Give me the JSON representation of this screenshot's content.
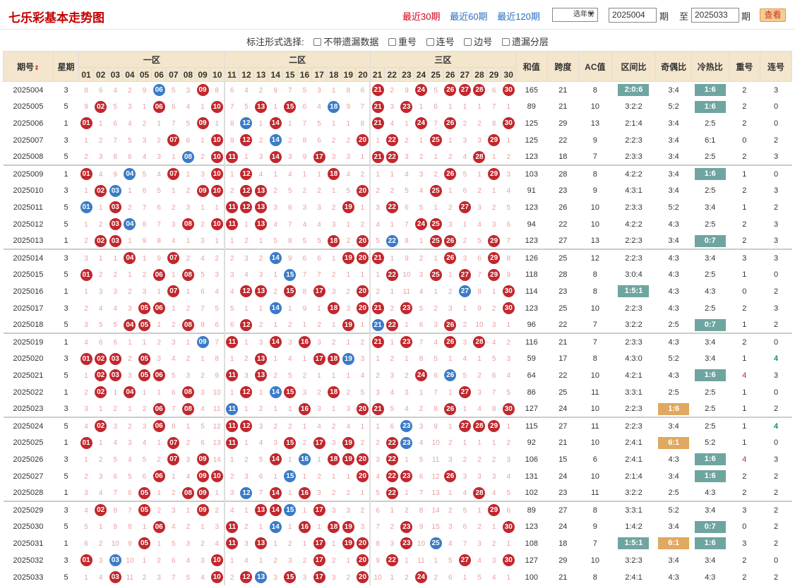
{
  "header": {
    "title": "七乐彩基本走势图",
    "ranges": [
      "最近30期",
      "最近60期",
      "最近120期"
    ],
    "year_select": "选年份",
    "start_issue": "2025004",
    "end_issue": "2025033",
    "label_from": "期",
    "label_to": "至",
    "label_issue": "期",
    "query": "查看"
  },
  "options": {
    "label": "标注形式选择:",
    "items": [
      "不带遗漏数据",
      "重号",
      "连号",
      "边号",
      "遗漏分层"
    ]
  },
  "columns": {
    "issue": "期号",
    "week": "星期",
    "zones": [
      "一区",
      "二区",
      "三区"
    ],
    "sum": "和值",
    "span": "跨度",
    "ac": "AC值",
    "zone_ratio": "区间比",
    "odd_even": "奇偶比",
    "hot_cold": "冷热比",
    "repeat": "重号",
    "consec": "连号"
  },
  "rows": [
    [
      "2025004",
      "3",
      [
        6,
        9,
        21,
        24,
        26,
        27,
        28,
        30
      ],
      [
        6
      ],
      "165",
      "21",
      "8",
      "2:0:6",
      "3:4",
      "1:6",
      "2",
      "3"
    ],
    [
      "2025005",
      "5",
      [
        2,
        6,
        10,
        13,
        15,
        18,
        21,
        23
      ],
      [
        18
      ],
      "89",
      "21",
      "10",
      "3:2:2",
      "5:2",
      "1:6",
      "2",
      "0"
    ],
    [
      "2025006",
      "1",
      [
        1,
        9,
        12,
        14,
        21,
        24,
        26,
        30
      ],
      [
        12
      ],
      "125",
      "29",
      "13",
      "2:1:4",
      "3:4",
      "2:5",
      "2",
      "0"
    ],
    [
      "2025007",
      "3",
      [
        7,
        10,
        12,
        14,
        20,
        22,
        25,
        29
      ],
      [
        14
      ],
      "125",
      "22",
      "9",
      "2:2:3",
      "3:4",
      "6:1",
      "0",
      "2"
    ],
    [
      "2025008",
      "5",
      [
        8,
        10,
        11,
        14,
        17,
        21,
        22,
        28
      ],
      [
        8
      ],
      "123",
      "18",
      "7",
      "2:3:3",
      "3:4",
      "2:5",
      "2",
      "3"
    ],
    [
      "2025009",
      "1",
      [
        1,
        4,
        7,
        10,
        12,
        18,
        26,
        29
      ],
      [
        4
      ],
      "103",
      "28",
      "8",
      "4:2:2",
      "3:4",
      "1:6",
      "1",
      "0"
    ],
    [
      "2025010",
      "3",
      [
        2,
        3,
        9,
        10,
        12,
        13,
        20,
        25
      ],
      [
        3
      ],
      "91",
      "23",
      "9",
      "4:3:1",
      "3:4",
      "2:5",
      "2",
      "3"
    ],
    [
      "2025011",
      "5",
      [
        1,
        3,
        11,
        12,
        13,
        19,
        22,
        27
      ],
      [
        1
      ],
      "123",
      "26",
      "10",
      "2:3:3",
      "5:2",
      "3:4",
      "1",
      "2"
    ],
    [
      "2025012",
      "5",
      [
        3,
        4,
        8,
        10,
        11,
        13,
        24,
        25
      ],
      [
        4
      ],
      "94",
      "22",
      "10",
      "4:2:2",
      "4:3",
      "2:5",
      "2",
      "3"
    ],
    [
      "2025013",
      "1",
      [
        2,
        3,
        18,
        20,
        22,
        25,
        26,
        29
      ],
      [
        22
      ],
      "123",
      "27",
      "13",
      "2:2:3",
      "3:4",
      "0:7",
      "2",
      "3"
    ],
    [
      "2025014",
      "3",
      [
        4,
        7,
        14,
        19,
        20,
        21,
        26,
        29
      ],
      [
        14
      ],
      "126",
      "25",
      "12",
      "2:2:3",
      "4:3",
      "3:4",
      "3",
      "3"
    ],
    [
      "2025015",
      "5",
      [
        1,
        6,
        8,
        15,
        22,
        25,
        27,
        29
      ],
      [
        15
      ],
      "118",
      "28",
      "8",
      "3:0:4",
      "4:3",
      "2:5",
      "1",
      "0"
    ],
    [
      "2025016",
      "1",
      [
        7,
        12,
        13,
        15,
        17,
        20,
        27,
        30
      ],
      [
        27
      ],
      "114",
      "23",
      "8",
      "1:5:1",
      "4:3",
      "4:3",
      "0",
      "2"
    ],
    [
      "2025017",
      "3",
      [
        5,
        6,
        14,
        18,
        20,
        21,
        23,
        30
      ],
      [
        14
      ],
      "123",
      "25",
      "10",
      "2:2:3",
      "4:3",
      "2:5",
      "2",
      "3"
    ],
    [
      "2025018",
      "5",
      [
        4,
        5,
        8,
        12,
        19,
        21,
        22,
        26
      ],
      [
        21
      ],
      "96",
      "22",
      "7",
      "3:2:2",
      "2:5",
      "0:7",
      "1",
      "2"
    ],
    [
      "2025019",
      "1",
      [
        9,
        11,
        14,
        16,
        21,
        23,
        26,
        28
      ],
      [
        9
      ],
      "116",
      "21",
      "7",
      "2:3:3",
      "4:3",
      "3:4",
      "2",
      "0"
    ],
    [
      "2025020",
      "3",
      [
        1,
        2,
        3,
        5,
        13,
        17,
        18,
        19
      ],
      [
        19
      ],
      "59",
      "17",
      "8",
      "4:3:0",
      "5:2",
      "3:4",
      "1",
      "4"
    ],
    [
      "2025021",
      "5",
      [
        2,
        3,
        5,
        6,
        11,
        13,
        24,
        26
      ],
      [
        26
      ],
      "64",
      "22",
      "10",
      "4:2:1",
      "4:3",
      "1:6",
      "4",
      "3"
    ],
    [
      "2025022",
      "1",
      [
        2,
        4,
        8,
        12,
        14,
        15,
        18,
        27
      ],
      [
        14
      ],
      "86",
      "25",
      "11",
      "3:3:1",
      "2:5",
      "2:5",
      "1",
      "0"
    ],
    [
      "2025023",
      "3",
      [
        6,
        8,
        11,
        16,
        20,
        21,
        26,
        30
      ],
      [
        11
      ],
      "127",
      "24",
      "10",
      "2:2:3",
      "1:6",
      "2:5",
      "1",
      "2"
    ],
    [
      "2025024",
      "5",
      [
        2,
        6,
        11,
        12,
        23,
        27,
        28,
        29
      ],
      [
        23
      ],
      "115",
      "27",
      "11",
      "2:2:3",
      "3:4",
      "2:5",
      "1",
      "4"
    ],
    [
      "2025025",
      "1",
      [
        1,
        7,
        11,
        15,
        17,
        19,
        22,
        23
      ],
      [
        23
      ],
      "92",
      "21",
      "10",
      "2:4:1",
      "6:1",
      "5:2",
      "1",
      "0"
    ],
    [
      "2025026",
      "3",
      [
        7,
        9,
        14,
        16,
        18,
        19,
        20,
        22
      ],
      [
        16
      ],
      "106",
      "15",
      "6",
      "2:4:1",
      "4:3",
      "1:6",
      "4",
      "3"
    ],
    [
      "2025027",
      "5",
      [
        6,
        9,
        10,
        15,
        20,
        22,
        23,
        26
      ],
      [
        15
      ],
      "131",
      "24",
      "10",
      "2:1:4",
      "3:4",
      "1:6",
      "2",
      "2"
    ],
    [
      "2025028",
      "1",
      [
        5,
        8,
        9,
        12,
        14,
        16,
        22,
        28
      ],
      [
        12
      ],
      "102",
      "23",
      "11",
      "3:2:2",
      "2:5",
      "4:3",
      "2",
      "2"
    ],
    [
      "2025029",
      "3",
      [
        2,
        5,
        9,
        13,
        14,
        15,
        17,
        29
      ],
      [
        15
      ],
      "89",
      "27",
      "8",
      "3:3:1",
      "5:2",
      "3:4",
      "3",
      "2"
    ],
    [
      "2025030",
      "5",
      [
        6,
        11,
        14,
        16,
        18,
        19,
        23,
        30
      ],
      [
        14
      ],
      "123",
      "24",
      "9",
      "1:4:2",
      "3:4",
      "0:7",
      "0",
      "2"
    ],
    [
      "2025031",
      "1",
      [
        5,
        11,
        13,
        17,
        19,
        20,
        23,
        25
      ],
      [
        25
      ],
      "108",
      "18",
      "7",
      "1:5:1",
      "6:1",
      "1:6",
      "3",
      "2"
    ],
    [
      "2025032",
      "3",
      [
        1,
        3,
        10,
        17,
        20,
        22,
        27,
        30
      ],
      [
        3
      ],
      "127",
      "29",
      "10",
      "3:2:3",
      "3:4",
      "3:4",
      "2",
      "0"
    ],
    [
      "2025033",
      "5",
      [
        3,
        10,
        12,
        13,
        15,
        17,
        20,
        24
      ],
      [
        13
      ],
      "100",
      "21",
      "8",
      "2:4:1",
      "4:3",
      "4:3",
      "2",
      "2"
    ]
  ],
  "badges": {
    "zone_ratio": [
      "2:0:6",
      "1:5:1"
    ],
    "hot_cold": [
      "1:6",
      "0:7"
    ],
    "odd_even": [
      "1:6",
      "6:1"
    ]
  },
  "colors": {
    "red": "#c1272d",
    "blue": "#3a7bc8",
    "header_bg": "#f3e6cc",
    "badge": "#6fa5a0",
    "gold": "#e0a860"
  }
}
